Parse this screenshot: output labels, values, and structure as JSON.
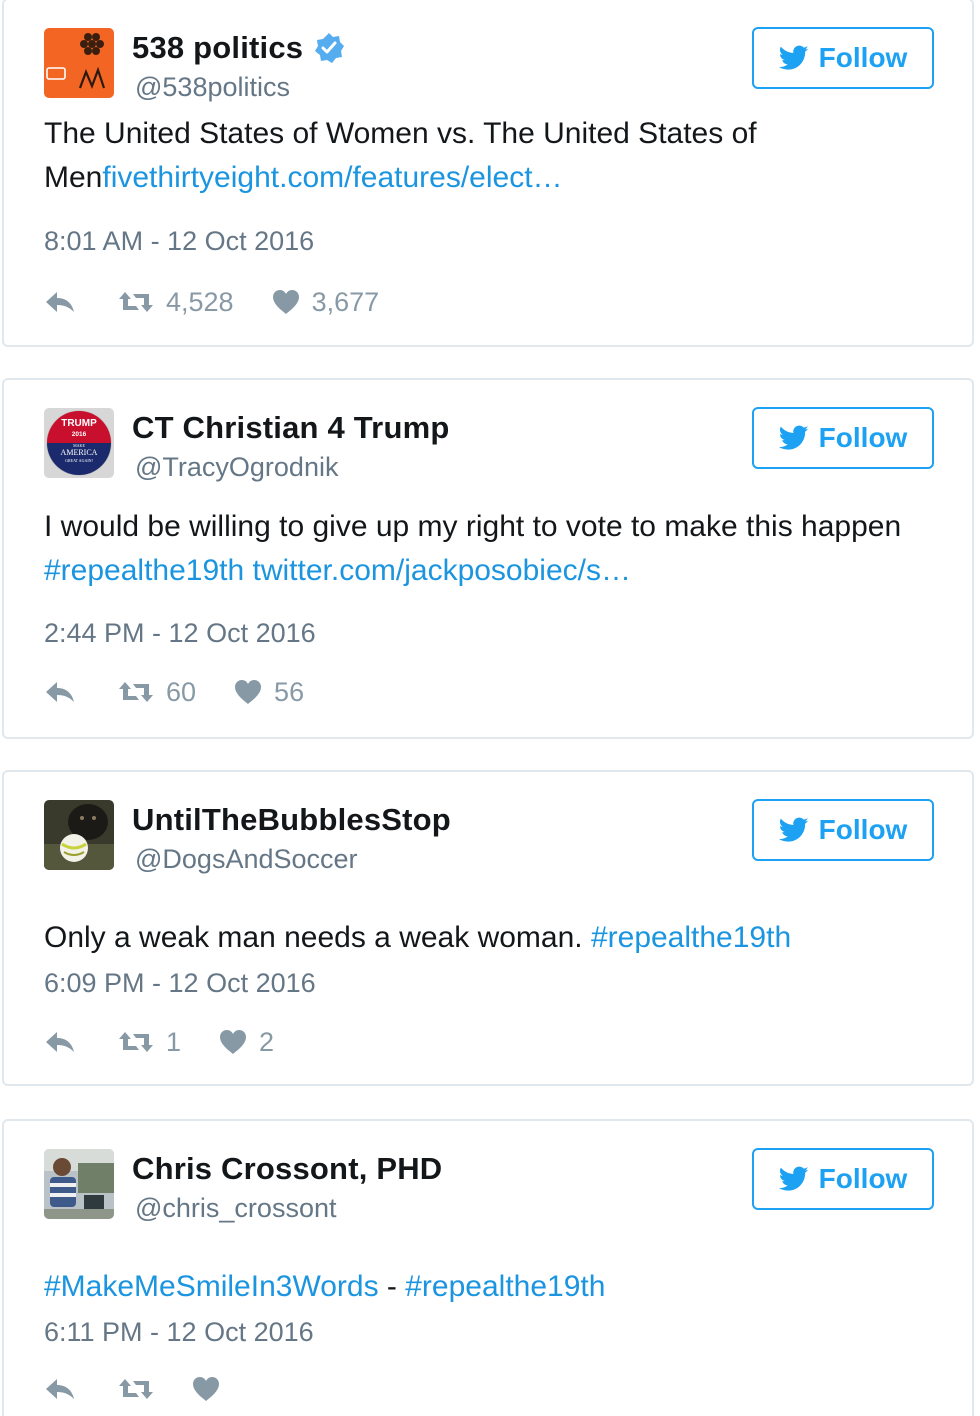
{
  "colors": {
    "link": "#1b95e0",
    "follow_accent": "#1da1f2",
    "meta_gray": "#657786",
    "icon_gray": "#8899a6",
    "border": "#e1e8ed"
  },
  "follow_label": "Follow",
  "tweets": [
    {
      "display_name": "538 politics",
      "verified": true,
      "handle": "@538politics",
      "text_plain": "The United States of Women vs. The United States of Men",
      "text_link": "fivethirtyeight.com/features/elect…",
      "timestamp": "8:01 AM - 12 Oct 2016",
      "retweets": "4,528",
      "likes": "3,677",
      "avatar_icon": "fivethirtyeight-logo-icon"
    },
    {
      "display_name": "CT Christian 4 Trump",
      "verified": false,
      "handle": "@TracyOgrodnik",
      "text_plain": "I would be willing to give up my right to vote to make this happen ",
      "text_hashtag": "#repealthe19th",
      "text_link": "twitter.com/jackposobiec/s…",
      "timestamp": "2:44 PM - 12 Oct 2016",
      "retweets": "60",
      "likes": "56",
      "avatar_icon": "trump-2016-badge-icon",
      "avatar_text": {
        "line1": "TRUMP",
        "line2": "2016",
        "line3": "MAKE",
        "line4": "AMERICA",
        "line5": "GREAT AGAIN!"
      }
    },
    {
      "display_name": "UntilTheBubblesStop",
      "verified": false,
      "handle": "@DogsAndSoccer",
      "text_plain": "Only a weak man needs a weak woman. ",
      "text_hashtag": "#repealthe19th",
      "timestamp": "6:09 PM - 12 Oct 2016",
      "retweets": "1",
      "likes": "2",
      "avatar_icon": "dog-with-soccer-ball-icon"
    },
    {
      "display_name": "Chris Crossont, PHD",
      "verified": false,
      "handle": "@chris_crossont",
      "text_hashtag_1": "#MakeMeSmileIn3Words",
      "text_separator": " - ",
      "text_hashtag_2": "#repealthe19th",
      "timestamp": "6:11 PM - 12 Oct 2016",
      "retweets": "",
      "likes": "",
      "avatar_icon": "person-photo-icon"
    }
  ]
}
